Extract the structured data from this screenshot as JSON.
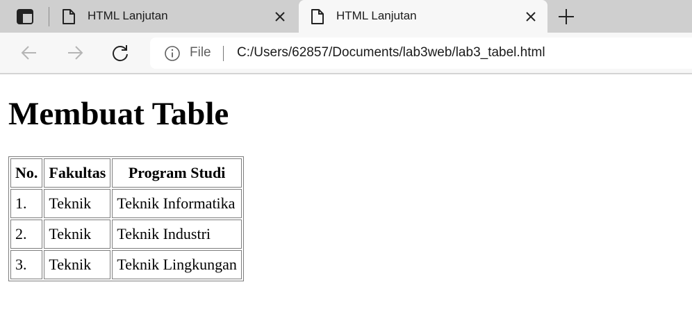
{
  "browser": {
    "tabs": [
      {
        "title": "HTML Lanjutan",
        "active": false
      },
      {
        "title": "HTML Lanjutan",
        "active": true
      }
    ],
    "address": {
      "scheme_label": "File",
      "url": "C:/Users/62857/Documents/lab3web/lab3_tabel.html"
    },
    "icons": [
      "tab-actions-icon",
      "document-icon",
      "close-icon",
      "plus-icon",
      "back-arrow-icon",
      "forward-arrow-icon",
      "reload-icon",
      "info-icon"
    ]
  },
  "page": {
    "heading": "Membuat Table",
    "table": {
      "headers": [
        "No.",
        "Fakultas",
        "Program Studi"
      ],
      "rows": [
        [
          "1.",
          "Teknik",
          "Teknik Informatika"
        ],
        [
          "2.",
          "Teknik",
          "Teknik Industri"
        ],
        [
          "3.",
          "Teknik",
          "Teknik Lingkungan"
        ]
      ]
    }
  }
}
